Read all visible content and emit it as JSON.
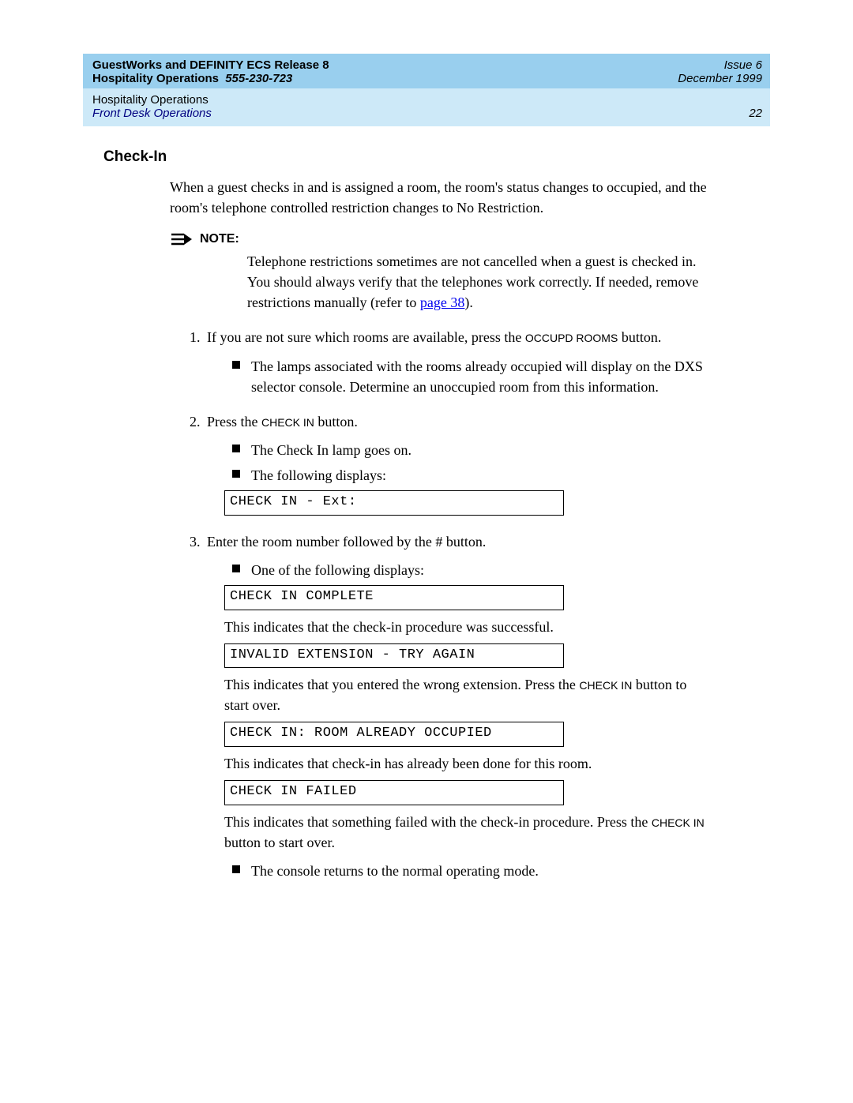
{
  "header": {
    "title_line": "GuestWorks and DEFINITY ECS Release 8",
    "doc_title": "Hospitality Operations",
    "doc_number": "555-230-723",
    "issue": "Issue 6",
    "date": "December 1999",
    "chapter": "Hospitality Operations",
    "section": "Front Desk Operations",
    "page": "22"
  },
  "section": {
    "heading": "Check-In",
    "intro": "When a guest checks in and is assigned a room, the room's status changes to occupied, and the room's telephone controlled restriction changes to No Restriction.",
    "note": {
      "label": "NOTE:",
      "text_pre": "Telephone restrictions sometimes are not cancelled when a guest is checked in. You should always verify that the telephones work correctly. If needed, remove restrictions manually (refer to ",
      "link": "page 38",
      "text_post": ")."
    },
    "steps": [
      {
        "num": "1.",
        "text_pre": "If you are not sure which rooms are available, press the ",
        "button": "OCCUPD ROOMS",
        "text_post": " button.",
        "bullets": [
          "The lamps associated with the rooms already occupied will display on the DXS selector console. Determine an unoccupied room from this information."
        ]
      },
      {
        "num": "2.",
        "text_pre": "Press the ",
        "button": "CHECK IN",
        "text_post": " button.",
        "bullets": [
          "The Check In lamp goes on.",
          "The following displays:"
        ],
        "display": "CHECK IN - Ext:"
      },
      {
        "num": "3.",
        "text_simple": "Enter the room number followed by the # button.",
        "bullets": [
          "One of the following displays:"
        ],
        "results": [
          {
            "display": "CHECK IN COMPLETE",
            "explain": "This indicates that the check-in procedure was successful."
          },
          {
            "display": "INVALID EXTENSION - TRY AGAIN",
            "explain_pre": "This indicates that you entered the wrong extension. Press the ",
            "explain_btn": "CHECK IN",
            "explain_post": " button to start over."
          },
          {
            "display": "CHECK IN: ROOM ALREADY OCCUPIED",
            "explain": "This indicates that check-in has already been done for this room."
          },
          {
            "display": "CHECK IN FAILED",
            "explain_pre": "This indicates that something failed with the check-in procedure. Press the ",
            "explain_btn": "CHECK IN",
            "explain_post": " button to start over."
          }
        ],
        "final_bullet": "The console returns to the normal operating mode."
      }
    ]
  }
}
